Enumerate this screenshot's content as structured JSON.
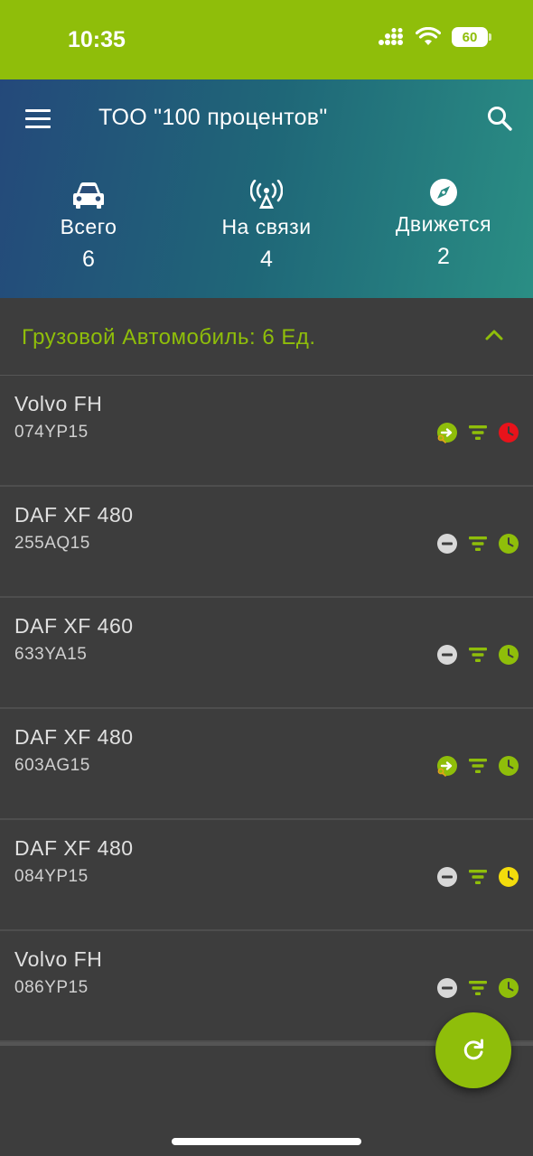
{
  "status_bar": {
    "time": "10:35",
    "battery": "60"
  },
  "header": {
    "title": "ТОО \"100 процентов\""
  },
  "stats": [
    {
      "label": "Всего",
      "value": "6",
      "icon": "car-icon"
    },
    {
      "label": "На связи",
      "value": "4",
      "icon": "antenna-icon"
    },
    {
      "label": "Движется",
      "value": "2",
      "icon": "compass-icon"
    }
  ],
  "group": {
    "title": "Грузовой Автомобиль: 6 Ед."
  },
  "vehicles": [
    {
      "name": "Volvo FH",
      "plate": "074YP15",
      "status": "moving",
      "clock": "red"
    },
    {
      "name": "DAF XF 480",
      "plate": "255AQ15",
      "status": "parked",
      "clock": "green"
    },
    {
      "name": "DAF XF 460",
      "plate": "633YA15",
      "status": "parked",
      "clock": "green"
    },
    {
      "name": "DAF XF 480",
      "plate": "603AG15",
      "status": "moving",
      "clock": "green"
    },
    {
      "name": "DAF XF 480",
      "plate": "084YP15",
      "status": "parked",
      "clock": "yellow"
    },
    {
      "name": "Volvo FH",
      "plate": "086YP15",
      "status": "parked",
      "clock": "green"
    }
  ],
  "colors": {
    "accent": "#8fbe0a",
    "clock_green": "#8fbe0a",
    "clock_red": "#e8131b",
    "clock_yellow": "#f3dc0c",
    "parked_grey": "#d8d8d8"
  }
}
